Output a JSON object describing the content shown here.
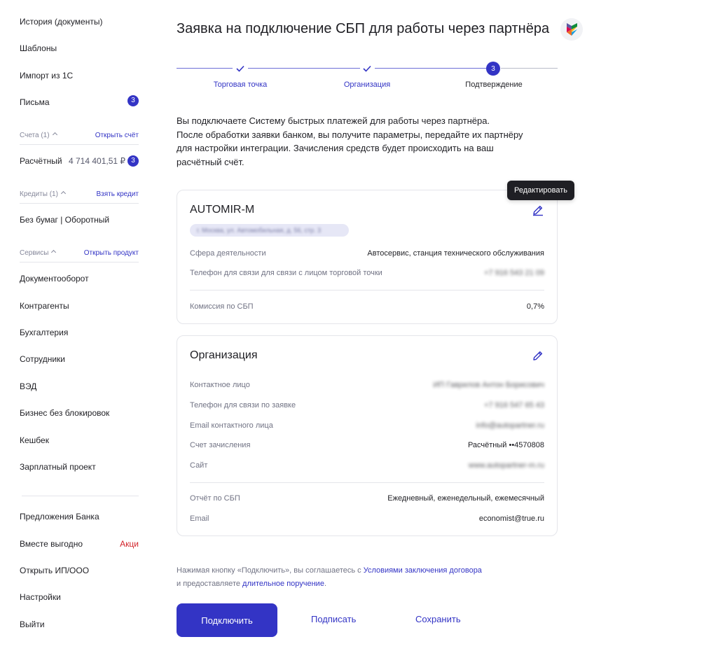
{
  "sidebar": {
    "top_items": [
      {
        "label": "История (документы)"
      },
      {
        "label": "Шаблоны"
      },
      {
        "label": "Импорт из 1С"
      },
      {
        "label": "Письма",
        "badge": "3"
      }
    ],
    "accounts_section": {
      "label": "Счета (1)",
      "action": "Открыть счёт"
    },
    "account": {
      "label": "Расчётный",
      "amount": "4 714 401,51 ₽",
      "badge": "3"
    },
    "credits_section": {
      "label": "Кредиты (1)",
      "action": "Взять кредит"
    },
    "credit": {
      "label": "Без бумаг | Оборотный"
    },
    "services_section": {
      "label": "Сервисы",
      "action": "Открыть продукт"
    },
    "service_items": [
      {
        "label": "Документооборот"
      },
      {
        "label": "Контрагенты"
      },
      {
        "label": "Бухгалтерия"
      },
      {
        "label": "Сотрудники"
      },
      {
        "label": "ВЭД"
      },
      {
        "label": "Бизнес без блокировок"
      },
      {
        "label": "Кешбек"
      },
      {
        "label": "Зарплатный проект"
      }
    ],
    "bottom_items": [
      {
        "label": "Предложения Банка"
      },
      {
        "label": "Вместе выгодно",
        "tag": "Акци"
      },
      {
        "label": "Открыть ИП/ООО"
      },
      {
        "label": "Настройки"
      },
      {
        "label": "Выйти"
      }
    ]
  },
  "page": {
    "title": "Заявка на подключение СБП для работы через партнёра",
    "logo_icon": "sbp-logo-icon"
  },
  "stepper": {
    "steps": [
      {
        "label": "Торговая точка",
        "state": "done"
      },
      {
        "label": "Организация",
        "state": "done"
      },
      {
        "label": "Подтверждение",
        "state": "current",
        "number": "3"
      }
    ]
  },
  "intro": {
    "lines": [
      "Вы подключаете Систему быстрых платежей для работы через партнёра.",
      "После обработки заявки банком, вы получите параметры, передайте их партнёру",
      "для настройки интеграции. Зачисления средств будет происходить на ваш",
      "расчётный счёт."
    ]
  },
  "store_card": {
    "title": "AUTOMIR-M",
    "address": "г. Москва, ул. Автомобильная, д. 56, стр. 3",
    "rows": [
      {
        "key": "Сфера деятельности",
        "value": "Автосервис, станция технического обслуживания"
      },
      {
        "key": "Телефон для связи для связи с лицом торговой точки",
        "value": "+7 916 543 21 09"
      }
    ],
    "fee": {
      "key": "Комиссия по СБП",
      "value": "0,7%"
    },
    "edit_tooltip": "Редактировать"
  },
  "org_card": {
    "title": "Организация",
    "rows": [
      {
        "key": "Контактное лицо",
        "value": "ИП Гаврилов Антон Борисович"
      },
      {
        "key": "Телефон для связи по заявке",
        "value": "+7 916 547 65 43"
      },
      {
        "key": "Email контактного лица",
        "value": "info@autopartner.ru"
      },
      {
        "key": "Счет зачисления",
        "value": "Расчётный ••4570808"
      },
      {
        "key": "Сайт",
        "value": "www.autopartner-m.ru"
      }
    ],
    "report_rows": [
      {
        "key": "Отчёт по СБП",
        "value": "Ежедневный, еженедельный, ежемесячный"
      },
      {
        "key": "Email",
        "value": "economist@true.ru"
      }
    ]
  },
  "consent": {
    "part1": "Нажимая кнопку «Подключить», вы соглашаетесь с ",
    "link1": "Условиями заключения договора",
    "part2": "и предоставляете ",
    "link2": "длительное поручение",
    "part3": "."
  },
  "actions": {
    "connect": "Подключить",
    "sign": "Подписать",
    "save": "Сохранить"
  },
  "colors": {
    "accent": "#3334c5",
    "danger": "#d2232a",
    "muted": "#717384"
  }
}
